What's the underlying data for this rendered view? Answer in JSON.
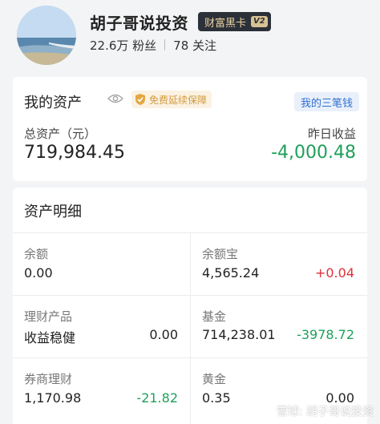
{
  "profile": {
    "name": "胡子哥说投资",
    "badge": "财富黑卡",
    "badge_level": "V2",
    "followers": "22.6万 粉丝",
    "following": "78 关注"
  },
  "assets": {
    "title": "我的资产",
    "guarantee_badge": "免费延续保障",
    "three_money_button": "我的三笔钱",
    "total_label": "总资产（元）",
    "total_value": "719,984.45",
    "yesterday_label": "昨日收益",
    "yesterday_value": "-4,000.48"
  },
  "details": {
    "title": "资产明细",
    "items": [
      {
        "label": "余额",
        "value": "0.00",
        "change": ""
      },
      {
        "label": "余额宝",
        "value": "4,565.24",
        "change": "+0.04"
      },
      {
        "label": "理财产品",
        "value": "收益稳健",
        "change": "0.00"
      },
      {
        "label": "基金",
        "value": "714,238.01",
        "change": "-3978.72"
      },
      {
        "label": "券商理财",
        "value": "1,170.98",
        "change": "-21.82"
      },
      {
        "label": "黄金",
        "value": "0.35",
        "change": "0.00"
      }
    ]
  },
  "watermark": "雪球: 胡子哥说投资",
  "colors": {
    "negative": "#1fa05a",
    "positive": "#e0303a",
    "accent_blue": "#2f6fd2",
    "badge_gold": "#d39a3c"
  },
  "icons": [
    "eye-icon",
    "shield-icon",
    "snowball-icon"
  ]
}
